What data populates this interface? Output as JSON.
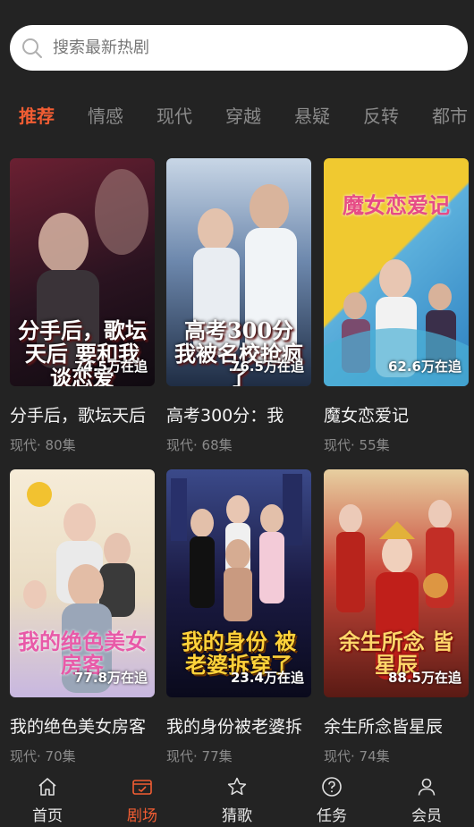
{
  "search": {
    "placeholder": "搜索最新热剧"
  },
  "tabs": [
    {
      "label": "推荐",
      "active": true
    },
    {
      "label": "情感"
    },
    {
      "label": "现代"
    },
    {
      "label": "穿越"
    },
    {
      "label": "悬疑"
    },
    {
      "label": "反转"
    },
    {
      "label": "都市"
    }
  ],
  "cards": [
    {
      "title": "分手后，歌坛天后",
      "poster_text": "分手后，歌坛天后 要和我谈恋爱",
      "followers": "74.5万在追",
      "meta": "现代· 80集",
      "colors": [
        "#5a1d2a",
        "#120c14"
      ]
    },
    {
      "title": "高考300分：我",
      "poster_text": "高考300分 我被名校抢疯了",
      "followers": "76.5万在追",
      "meta": "现代· 68集",
      "colors": [
        "#8aa7c8",
        "#1d2b40"
      ]
    },
    {
      "title": "魔女恋爱记",
      "poster_text": "魔女恋爱记",
      "followers": "62.6万在追",
      "meta": "现代· 55集",
      "colors": [
        "#f0c930",
        "#4aa8d8"
      ]
    },
    {
      "title": "我的绝色美女房客",
      "poster_text": "我的绝色美女房客",
      "followers": "77.8万在追",
      "meta": "现代· 70集",
      "colors": [
        "#f3e6cf",
        "#b7a4d6"
      ]
    },
    {
      "title": "我的身份被老婆拆",
      "poster_text": "我的身份 被老婆拆穿了",
      "followers": "23.4万在追",
      "meta": "现代· 77集",
      "colors": [
        "#2a2f6a",
        "#0c0c22"
      ]
    },
    {
      "title": "余生所念皆星辰",
      "poster_text": "余生所念 皆星辰",
      "followers": "88.5万在追",
      "meta": "现代· 74集",
      "colors": [
        "#c43a2a",
        "#5a1a14"
      ]
    }
  ],
  "nav": [
    {
      "label": "首页",
      "icon": "home-icon"
    },
    {
      "label": "剧场",
      "icon": "theater-icon",
      "active": true
    },
    {
      "label": "猜歌",
      "icon": "star-icon"
    },
    {
      "label": "任务",
      "icon": "question-icon"
    },
    {
      "label": "会员",
      "icon": "user-icon"
    }
  ],
  "colors": {
    "accent": "#f25d33",
    "background": "#232323"
  }
}
